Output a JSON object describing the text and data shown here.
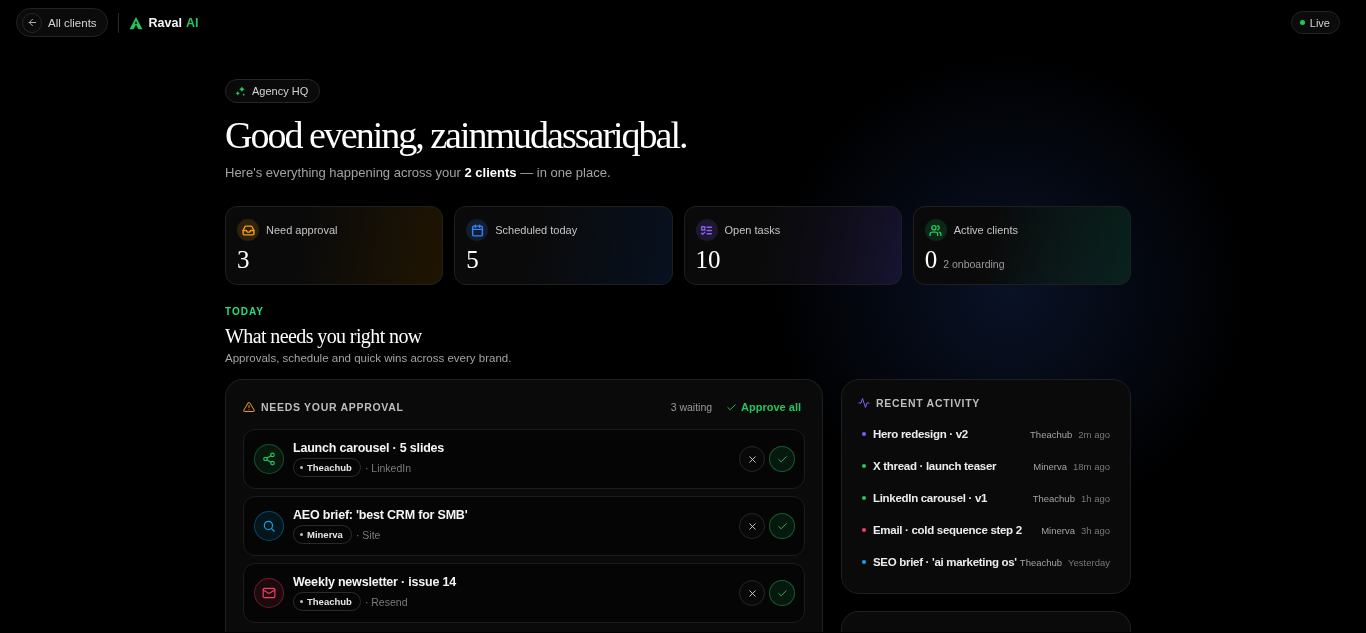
{
  "top_bar": {
    "back_button": {
      "label": "All clients"
    },
    "brand": {
      "name": "Raval",
      "suffix": "AI"
    },
    "status": {
      "label": "Live",
      "on": true
    }
  },
  "header": {
    "badge": "Agency HQ",
    "greeting": "Good evening, zainmudassariqbal.",
    "summary": "Here's everything happening across your **2 clients** — in one place."
  },
  "stats": [
    {
      "kind": "approval",
      "label": "Need approval",
      "value": "3",
      "color": "#f59e0b"
    },
    {
      "kind": "scheduled",
      "label": "Scheduled today",
      "value": "5",
      "color": "#3b82f6"
    },
    {
      "kind": "tasks",
      "label": "Open tasks",
      "value": "10",
      "color": "#8b5cf6"
    },
    {
      "kind": "clients",
      "label": "Active clients",
      "value": "0",
      "note": "2 onboarding",
      "color": "#22c55e"
    }
  ],
  "today": {
    "eyebrow": "TODAY",
    "title": "What needs you right now",
    "subtitle": "Approvals, schedule and quick wins across every brand."
  },
  "approvals": {
    "title": "NEEDS YOUR APPROVAL",
    "count": "3 waiting",
    "action": "Approve all",
    "items": [
      {
        "kind": "share",
        "title": "Launch carousel · 5 slides",
        "client": "Theachub",
        "channel": "· LinkedIn",
        "color": "#22c55e"
      },
      {
        "kind": "search",
        "title": "AEO brief: 'best CRM for SMB'",
        "client": "Minerva",
        "channel": "· Site",
        "color": "#0ea5e9"
      },
      {
        "kind": "mail",
        "title": "Weekly newsletter · issue 14",
        "client": "Theachub",
        "channel": "· Resend",
        "color": "#f43f5e"
      }
    ]
  },
  "activity": {
    "title": "RECENT ACTIVITY",
    "items": [
      {
        "title": "Hero redesign · v2",
        "client": "Theachub",
        "time": "2m ago",
        "color": "#8b5cf6"
      },
      {
        "title": "X thread · launch teaser",
        "client": "Minerva",
        "time": "18m ago",
        "color": "#22c55e"
      },
      {
        "title": "LinkedIn carousel · v1",
        "client": "Theachub",
        "time": "1h ago",
        "color": "#22c55e"
      },
      {
        "title": "Email · cold sequence step 2",
        "client": "Minerva",
        "time": "3h ago",
        "color": "#f43f5e"
      },
      {
        "title": "SEO brief · 'ai marketing os'",
        "client": "Theachub",
        "time": "Yesterday",
        "color": "#0ea5e9"
      }
    ]
  }
}
